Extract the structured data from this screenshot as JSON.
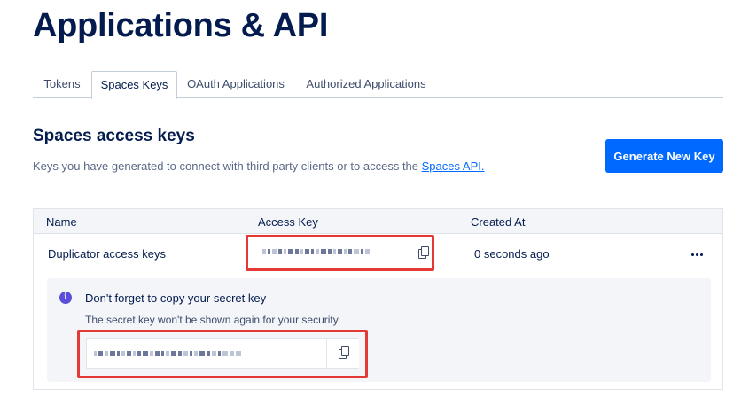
{
  "page": {
    "title": "Applications & API"
  },
  "tabs": [
    {
      "label": "Tokens",
      "active": false
    },
    {
      "label": "Spaces Keys",
      "active": true
    },
    {
      "label": "OAuth Applications",
      "active": false
    },
    {
      "label": "Authorized Applications",
      "active": false
    }
  ],
  "section": {
    "title": "Spaces access keys",
    "description": "Keys you have generated to connect with third party clients or to access the ",
    "link_text": "Spaces API.",
    "generate_button": "Generate New Key"
  },
  "table": {
    "headers": [
      "Name",
      "Access Key",
      "Created At"
    ],
    "rows": [
      {
        "name": "Duplicator access keys",
        "created_at": "0 seconds ago"
      }
    ]
  },
  "notice": {
    "title": "Don't forget to copy your secret key",
    "description": "The secret key won't be shown again for your security."
  },
  "icons": {
    "copy": "copy-icon",
    "info": "info-icon",
    "more": "more-horizontal-icon"
  },
  "colors": {
    "accent": "#0069ff",
    "highlight_border": "#e53935",
    "info": "#5b4fd9",
    "title": "#031b4e"
  }
}
